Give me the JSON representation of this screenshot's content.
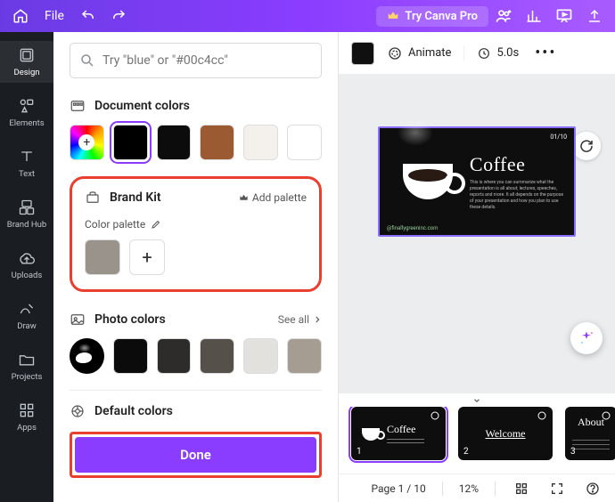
{
  "topbar": {
    "file_label": "File",
    "try_pro_label": "Try Canva Pro"
  },
  "rail": {
    "items": [
      {
        "label": "Design"
      },
      {
        "label": "Elements"
      },
      {
        "label": "Text"
      },
      {
        "label": "Brand Hub"
      },
      {
        "label": "Uploads"
      },
      {
        "label": "Draw"
      },
      {
        "label": "Projects"
      },
      {
        "label": "Apps"
      }
    ]
  },
  "panel": {
    "search_placeholder": "Try \"blue\" or \"#00c4cc\"",
    "doc_colors_title": "Document colors",
    "doc_colors": [
      {
        "color": "#000000",
        "selected": true
      },
      {
        "color": "#0c0c0c"
      },
      {
        "color": "#9c5a33"
      },
      {
        "color": "#f4f1ec"
      },
      {
        "color": "#ffffff"
      }
    ],
    "brand_kit_title": "Brand Kit",
    "add_palette_label": "Add palette",
    "color_palette_label": "Color palette",
    "brand_colors": [
      {
        "color": "#9a938c"
      }
    ],
    "photo_colors_title": "Photo colors",
    "see_all_label": "See all",
    "photo_colors": [
      {
        "color": "#0b0b0b"
      },
      {
        "color": "#2e2c2b"
      },
      {
        "color": "#56504a"
      },
      {
        "color": "#e3e1de"
      },
      {
        "color": "#a59d92"
      }
    ],
    "default_colors_title": "Default colors",
    "done_label": "Done"
  },
  "canvas": {
    "animate_label": "Animate",
    "duration_label": "5.0s",
    "slide": {
      "title": "Coffee",
      "page_badge": "01/10",
      "footer": "@finallygreeninc.com",
      "desc": "This is where you can summarize what the presentation is all about; lectures, speeches, reports and more. It all depends on the purpose of your presentation and how you plan to use these details."
    }
  },
  "thumbs": [
    {
      "n": "1",
      "title": "Coffee"
    },
    {
      "n": "2",
      "title": "Welcome"
    },
    {
      "n": "3",
      "title": "About"
    }
  ],
  "status": {
    "page_label": "Page 1 / 10",
    "zoom_label": "12%"
  }
}
